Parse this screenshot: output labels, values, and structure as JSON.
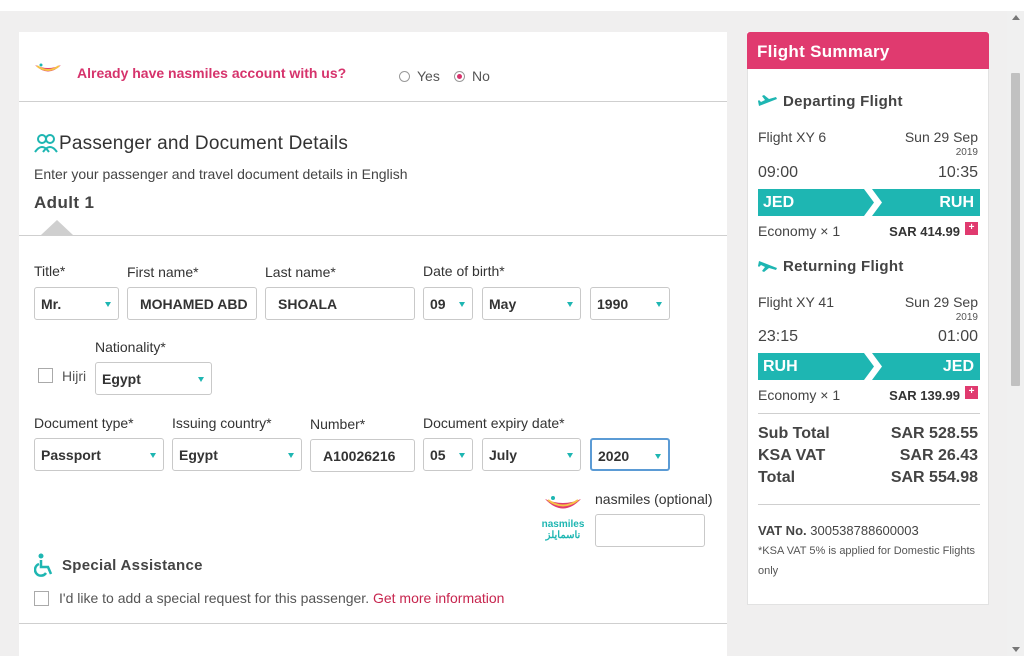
{
  "colors": {
    "accent": "#e03a6f",
    "teal": "#1eb6b2",
    "link": "#c7254e"
  },
  "account": {
    "question": "Already have nasmiles account with us?",
    "yes_label": "Yes",
    "no_label": "No",
    "selected": "No"
  },
  "passenger": {
    "section_title": "Passenger and Document Details",
    "subtitle": "Enter your passenger and travel document details in English",
    "adult_label": "Adult 1",
    "title_label": "Title*",
    "title_value": "Mr.",
    "first_name_label": "First name*",
    "first_name_value": "MOHAMED ABD",
    "last_name_label": "Last name*",
    "last_name_value": "SHOALA",
    "dob_label": "Date of birth*",
    "dob_day": "09",
    "dob_month": "May",
    "dob_year": "1990",
    "hijri_label": "Hijri",
    "nationality_label": "Nationality*",
    "nationality_value": "Egypt",
    "doc_type_label": "Document type*",
    "doc_type_value": "Passport",
    "issuing_label": "Issuing country*",
    "issuing_value": "Egypt",
    "number_label": "Number*",
    "number_value": "A10026216",
    "expiry_label": "Document expiry date*",
    "expiry_day": "05",
    "expiry_month": "July",
    "expiry_year": "2020",
    "nasmiles_label": "nasmiles (optional)",
    "nasmiles_value": "",
    "nasmiles_logo_text": "nasmiles",
    "nasmiles_logo_arabic": "ناسمايلز"
  },
  "assistance": {
    "title": "Special Assistance",
    "checkbox_label": "I'd like to add a special request for this passenger.",
    "link": "Get more information"
  },
  "summary": {
    "header": "Flight Summary",
    "departing": {
      "title": "Departing Flight",
      "flight": "Flight XY 6",
      "date": "Sun 29 Sep",
      "year": "2019",
      "dep_time": "09:00",
      "arr_time": "10:35",
      "from": "JED",
      "to": "RUH",
      "fare": "Economy × 1",
      "price": "SAR 414.99"
    },
    "returning": {
      "title": "Returning Flight",
      "flight": "Flight XY 41",
      "date": "Sun 29 Sep",
      "year": "2019",
      "dep_time": "23:15",
      "arr_time": "01:00",
      "from": "RUH",
      "to": "JED",
      "fare": "Economy × 1",
      "price": "SAR 139.99"
    },
    "subtotal_label": "Sub Total",
    "subtotal": "SAR 528.55",
    "vat_label": "KSA VAT",
    "vat": "SAR 26.43",
    "total_label": "Total",
    "total": "SAR 554.98",
    "vat_no_label": "VAT No.",
    "vat_no": "300538788600003",
    "vat_note": "*KSA VAT 5% is applied for Domestic Flights only",
    "plus": "+"
  }
}
